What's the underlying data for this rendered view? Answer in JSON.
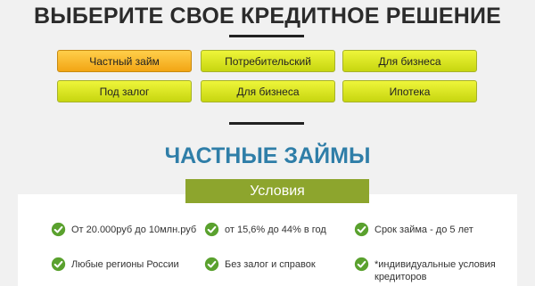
{
  "header": {
    "title": "ВЫБЕРИТЕ СВОЕ КРЕДИТНОЕ РЕШЕНИЕ"
  },
  "options": [
    {
      "label": "Частный займ",
      "active": true
    },
    {
      "label": "Потребительский",
      "active": false
    },
    {
      "label": "Для бизнеса",
      "active": false
    },
    {
      "label": "Под залог",
      "active": false
    },
    {
      "label": "Для бизнеса",
      "active": false
    },
    {
      "label": "Ипотека",
      "active": false
    }
  ],
  "section": {
    "title": "ЧАСТНЫЕ ЗАЙМЫ",
    "conditions_label": "Условия",
    "items": [
      {
        "text": "От 20.000руб до 10млн.руб",
        "icon": "check-icon"
      },
      {
        "text": "от 15,6% до 44% в год",
        "icon": "check-icon"
      },
      {
        "text": "Срок займа - до 5 лет",
        "icon": "check-icon"
      },
      {
        "text": "Любые регионы России",
        "icon": "check-icon"
      },
      {
        "text": "Без залог и справок",
        "icon": "check-icon"
      },
      {
        "text": "*индивидуальные условия кредиторов",
        "icon": "check-icon"
      }
    ]
  },
  "colors": {
    "accent_blue": "#2f7ea8",
    "button_green": "#d6e22a",
    "button_active_orange": "#f7b52a",
    "conditions_green": "#8da52d",
    "check_green": "#5aa12e"
  }
}
